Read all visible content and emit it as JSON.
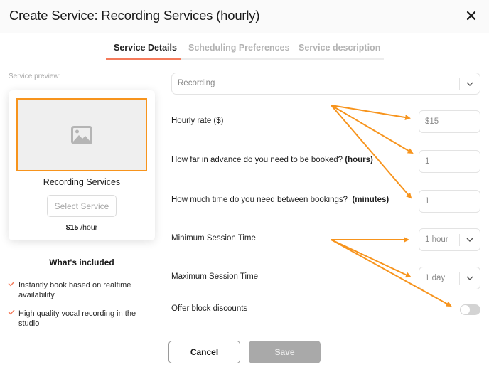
{
  "header": {
    "title": "Create Service: Recording Services (hourly)",
    "close_icon": "close-icon"
  },
  "tabs": [
    {
      "label": "Service Details",
      "active": true
    },
    {
      "label": "Scheduling Preferences",
      "active": false
    },
    {
      "label": "Service description",
      "active": false
    }
  ],
  "preview": {
    "label": "Service preview:",
    "image_icon": "image-placeholder-icon",
    "name": "Recording Services",
    "button_label": "Select Service",
    "price": "$15",
    "unit": "/hour"
  },
  "included": {
    "title": "What's included",
    "items": [
      "Instantly book based on realtime availability",
      "High quality vocal recording in the studio"
    ],
    "check_color": "#f47a5a"
  },
  "form": {
    "category": {
      "value": "Recording"
    },
    "hourly_rate": {
      "label": "Hourly rate ($)",
      "value": "$15"
    },
    "advance": {
      "label": "How far in advance do you need to be booked?",
      "unit": "(hours)",
      "value": "1"
    },
    "between": {
      "label": "How much time do you need between bookings?",
      "unit": "(minutes)",
      "value": "1"
    },
    "min_session": {
      "label": "Minimum Session Time",
      "value": "1 hour"
    },
    "max_session": {
      "label": "Maximum Session Time",
      "value": "1 day"
    },
    "block_discounts": {
      "label": "Offer block discounts",
      "enabled": false
    }
  },
  "footer": {
    "cancel_label": "Cancel",
    "save_label": "Save"
  },
  "colors": {
    "accent": "#f47a5a",
    "annotation": "#f7941d"
  }
}
